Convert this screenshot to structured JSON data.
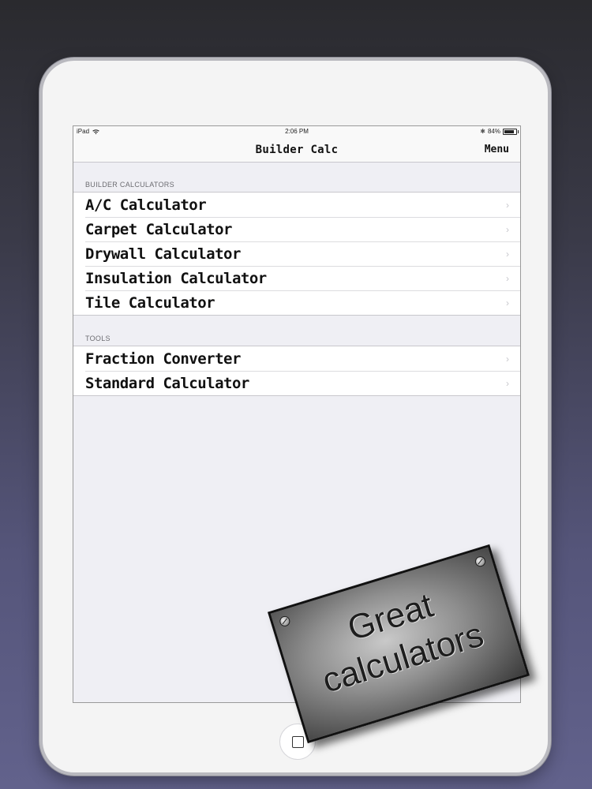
{
  "status_bar": {
    "device": "iPad",
    "time": "2:06 PM",
    "battery": "84%",
    "battery_level": 0.84
  },
  "nav": {
    "title": "Builder Calc",
    "menu": "Menu"
  },
  "sections": [
    {
      "header": "BUILDER CALCULATORS",
      "items": [
        {
          "label": "A/C Calculator"
        },
        {
          "label": "Carpet Calculator"
        },
        {
          "label": "Drywall Calculator"
        },
        {
          "label": "Insulation Calculator"
        },
        {
          "label": "Tile Calculator"
        }
      ]
    },
    {
      "header": "TOOLS",
      "items": [
        {
          "label": "Fraction Converter"
        },
        {
          "label": "Standard Calculator"
        }
      ]
    }
  ],
  "sign": {
    "line1": "Great",
    "line2": "calculators"
  },
  "icons": {
    "row_chevron": "chevron-right-icon",
    "home": "home-button-icon"
  }
}
